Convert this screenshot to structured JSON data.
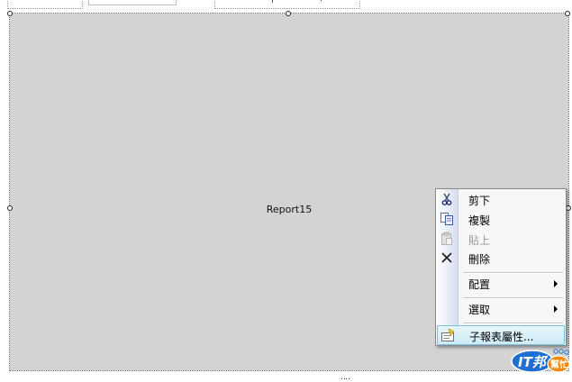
{
  "canvas": {
    "report_name": "Report15"
  },
  "context_menu": {
    "items": [
      {
        "label": "剪下",
        "icon": "scissors-icon",
        "enabled": true
      },
      {
        "label": "複製",
        "icon": "copy-icon",
        "enabled": true
      },
      {
        "label": "貼上",
        "icon": "paste-icon",
        "enabled": false
      },
      {
        "label": "刪除",
        "icon": "delete-x-icon",
        "enabled": true
      },
      {
        "label": "配置",
        "submenu": true,
        "enabled": true
      },
      {
        "label": "選取",
        "submenu": true,
        "enabled": true
      },
      {
        "label": "子報表屬性...",
        "icon": "properties-icon",
        "enabled": true,
        "highlighted": true
      }
    ]
  },
  "watermark": {
    "text_main": "iT邦",
    "text_sub": "幫忙"
  },
  "colors": {
    "canvas_bg": "#d3d3d3",
    "menu_highlight": "#cdebf8",
    "watermark_blue": "#1e6fd0",
    "watermark_orange": "#f08a12"
  }
}
